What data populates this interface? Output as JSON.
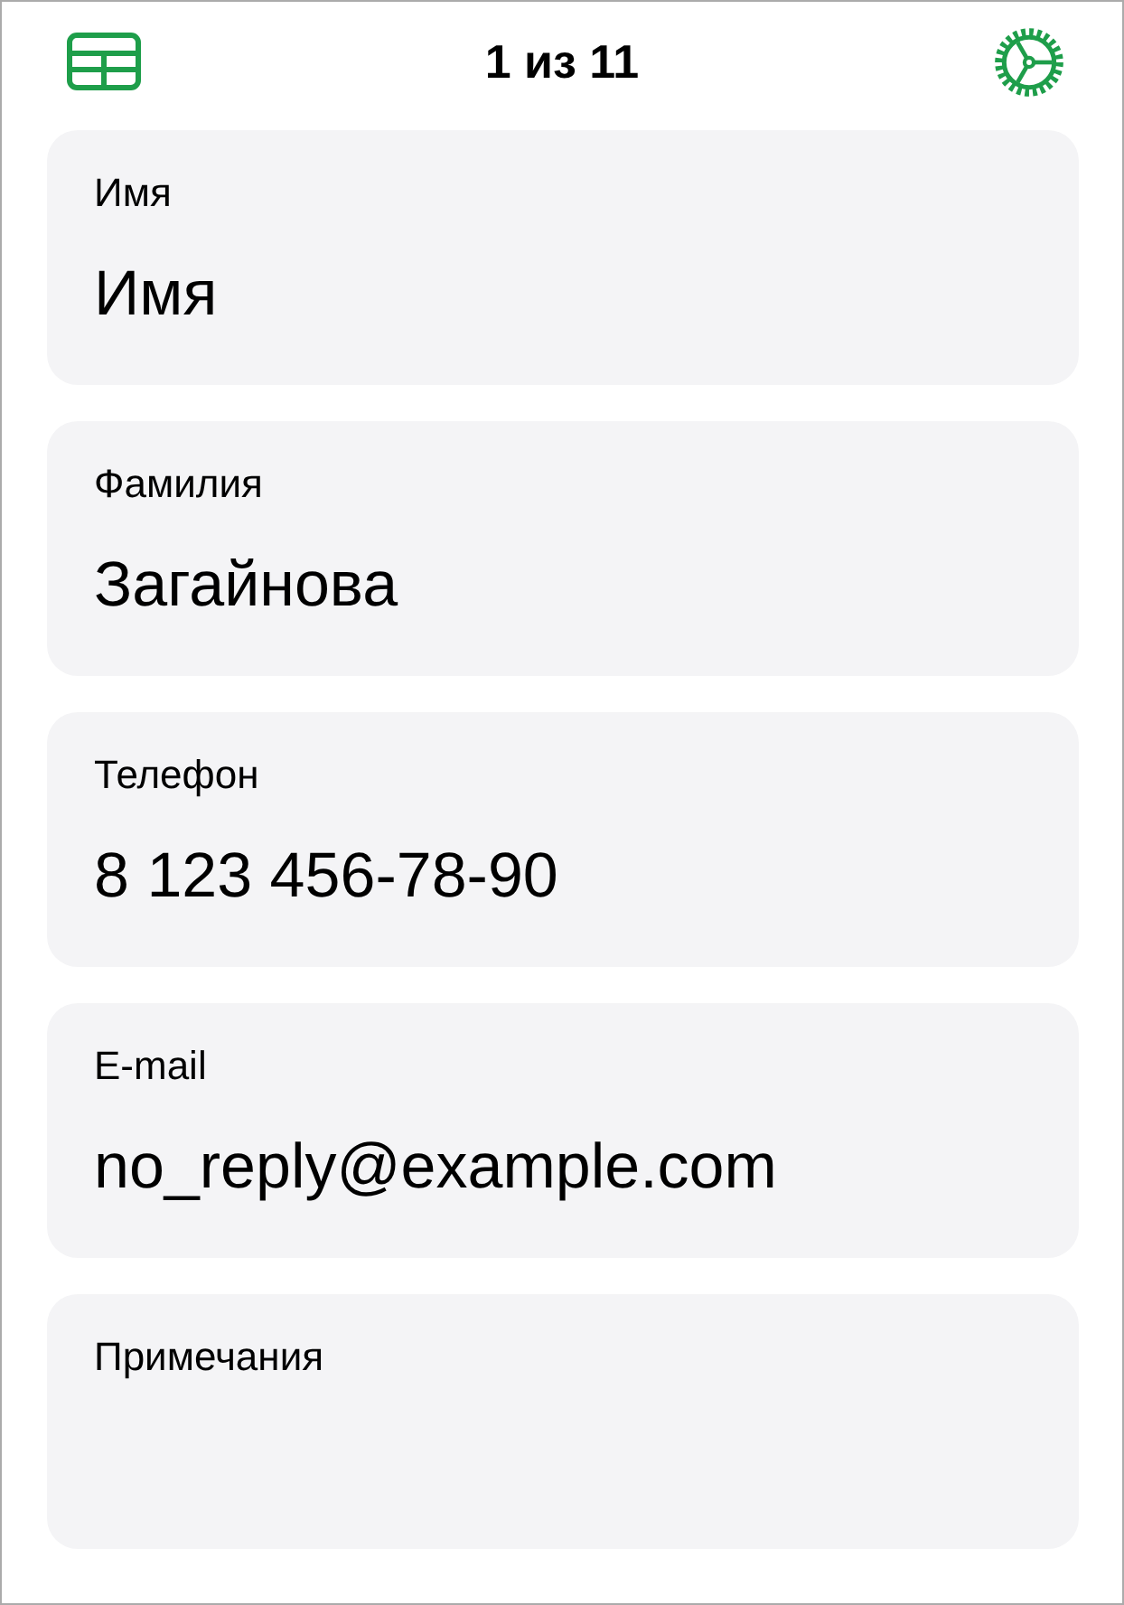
{
  "toolbar": {
    "title": "1 из 11"
  },
  "fields": [
    {
      "label": "Имя",
      "value": "Имя"
    },
    {
      "label": "Фамилия",
      "value": "Загайнова"
    },
    {
      "label": "Телефон",
      "value": "8 123 456-78-90"
    },
    {
      "label": "E-mail",
      "value": "no_reply@example.com"
    },
    {
      "label": "Примечания"
    }
  ]
}
